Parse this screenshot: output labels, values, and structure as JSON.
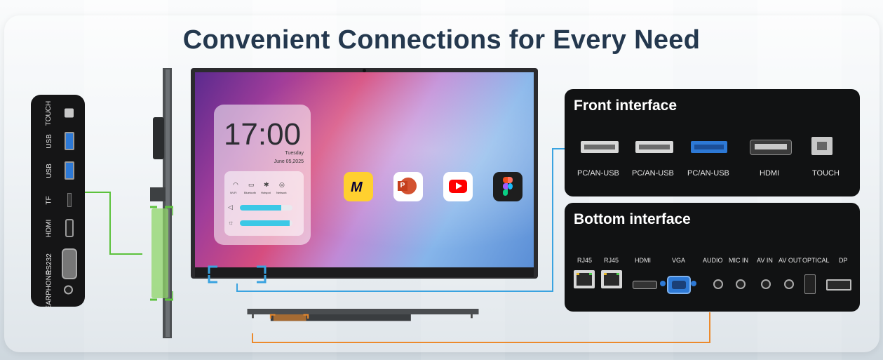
{
  "title": "Convenient Connections for Every Need",
  "side_ports": [
    "TOUCH",
    "USB",
    "USB",
    "TF",
    "HDMI",
    "RS232",
    "EARPHONE"
  ],
  "screen": {
    "clock": "17:00",
    "day": "Tuesday",
    "date": "June  05,2025",
    "controls": [
      "Wi-Fi",
      "Bluetooth",
      "Hotspot",
      "Network"
    ],
    "volume_level": 0.78,
    "brightness_level": 0.95,
    "apps": [
      "miro-icon",
      "powerpoint-icon",
      "youtube-icon",
      "figma-icon"
    ]
  },
  "front": {
    "title": "Front interface",
    "ports": [
      "PC/AN-USB",
      "PC/AN-USB",
      "PC/AN-USB",
      "HDMI",
      "TOUCH"
    ]
  },
  "bottom": {
    "title": "Bottom interface",
    "ports": [
      "RJ45",
      "RJ45",
      "HDMI",
      "VGA",
      "AUDIO",
      "MIC IN",
      "AV IN",
      "AV OUT",
      "OPTICAL",
      "DP"
    ]
  },
  "colors": {
    "title": "#24384e",
    "side_connector": "#5cc23c",
    "front_connector": "#3aa3e0",
    "bottom_connector": "#ec8a2c",
    "usb3_blue": "#2d79d6"
  }
}
